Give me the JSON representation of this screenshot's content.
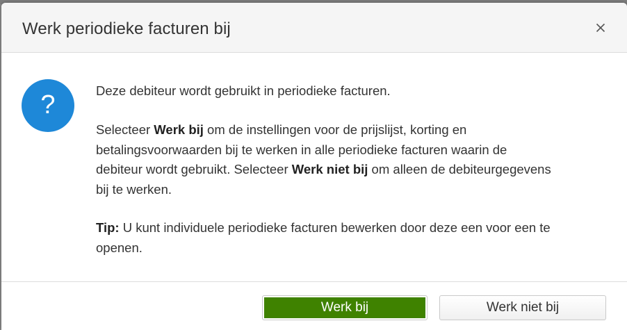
{
  "dialog": {
    "title": "Werk periodieke facturen bij",
    "close_icon": "close-icon",
    "question_icon": "question-icon",
    "question_glyph": "?",
    "paragraph1": "Deze debiteur wordt gebruikt in periodieke facturen.",
    "paragraph2": {
      "part1": "Selecteer ",
      "bold1": "Werk bij",
      "part2": " om de instellingen voor de prijslijst, korting en betalingsvoorwaarden bij te werken in alle periodieke facturen waarin de debiteur wordt gebruikt. Selecteer ",
      "bold2": "Werk niet bij",
      "part3": " om alleen de debiteurgegevens bij te werken."
    },
    "paragraph3": {
      "tip_label": "Tip:",
      "tip_text": " U kunt individuele periodieke facturen bewerken door deze een voor een te openen."
    },
    "buttons": {
      "primary_label": "Werk bij",
      "secondary_label": "Werk niet bij"
    },
    "colors": {
      "primary_button": "#3f8200",
      "question_icon": "#1e88d8"
    }
  }
}
